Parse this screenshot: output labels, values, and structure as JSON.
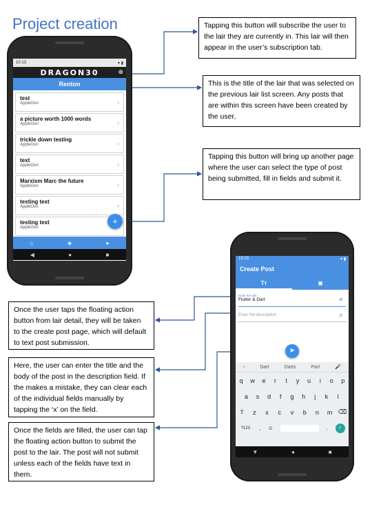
{
  "page_title": "Project creation",
  "callouts": {
    "subscribe": "Tapping this button will subscribe the user to the lair they are currently in. This lair will then appear in the user’s subscription tab.",
    "lair_title": "This is the title of the lair that was selected on the previous lair list screen. Any posts that are within this screen have been created by the user.",
    "fab": "Tapping this button will bring up another page where the user can select the type of post being submitted, fill in fields and submit it.",
    "create_page": "Once the user taps the floating action button from lair detail, they will be taken to the create post page, which will default to text post submission.",
    "enter_fields": "Here, the user can enter the title and the body of the post in the description field. If the makes a mistake, they can clear each of the individual fields manually by tapping the ‘x’ on the field.",
    "submit": "Once the fields are filled, the user can tap the floating action button to submit the post to the lair. The post will not submit unless each of the fields have text in them."
  },
  "phone1": {
    "time": "10:13",
    "app_name": "DRAGON30",
    "lair_name": "Renton",
    "posts": [
      {
        "title": "test",
        "author": "AppleOon"
      },
      {
        "title": "a picture worth 1000 words",
        "author": "AppleOon"
      },
      {
        "title": "trickle down testing",
        "author": "AppleOon"
      },
      {
        "title": "text",
        "author": "AppleOon"
      },
      {
        "title": "Marxism Marc the future",
        "author": "AppleOon"
      },
      {
        "title": "testing text",
        "author": "AppleOon"
      },
      {
        "title": "testing text",
        "author": "AppleOon"
      }
    ],
    "fab_label": "+",
    "nav_icons": [
      "home-icon",
      "layers-icon",
      "person-icon"
    ]
  },
  "phone2": {
    "time": "10:13",
    "appbar_title": "Create Post",
    "tab_text": "Tт",
    "tab_image": "▣",
    "title_field_label": "Enter the title",
    "title_field_value": "Flutter & Dart",
    "description_placeholder": "Enter the description",
    "clear_glyph": "✕",
    "suggestions": [
      "Dart",
      "Darts",
      "Part"
    ],
    "keyboard_rows": [
      [
        "q",
        "w",
        "e",
        "r",
        "t",
        "y",
        "u",
        "i",
        "o",
        "p"
      ],
      [
        "a",
        "s",
        "d",
        "f",
        "g",
        "h",
        "j",
        "k",
        "l"
      ],
      [
        "⇧",
        "z",
        "x",
        "c",
        "v",
        "b",
        "n",
        "m",
        "⌫"
      ],
      [
        "?123",
        ",",
        "☺",
        "",
        ".",
        "✓"
      ]
    ],
    "key_hints": [
      "1",
      "2",
      "3",
      "4",
      "5",
      "6",
      "7",
      "8",
      "9",
      "0"
    ]
  },
  "colors": {
    "title_blue": "#4472c4",
    "app_blue": "#4a90e2",
    "arrow_blue": "#2f5597"
  }
}
